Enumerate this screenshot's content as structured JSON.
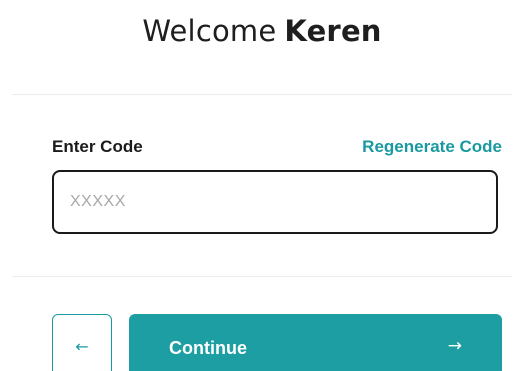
{
  "header": {
    "greeting": "Welcome",
    "name": "Keren"
  },
  "code_form": {
    "label": "Enter Code",
    "regenerate_label": "Regenerate Code",
    "input_value": "",
    "input_placeholder": "XXXXX"
  },
  "actions": {
    "back_icon": "arrow-left-icon",
    "back_glyph": "←",
    "continue_label": "Continue",
    "continue_icon": "arrow-right-icon",
    "continue_glyph": "→"
  },
  "colors": {
    "accent": "#1d9ea3",
    "text": "#1c1c1c",
    "placeholder": "#a8a8a8"
  }
}
